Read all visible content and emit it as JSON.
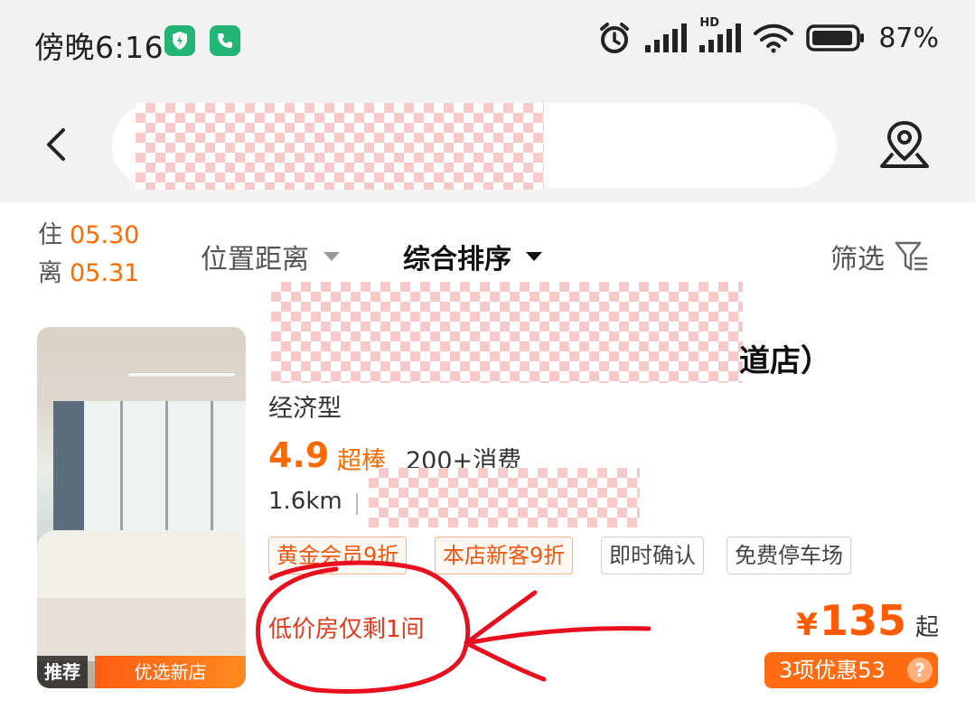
{
  "status_bar": {
    "time": "傍晚6:16",
    "battery": "87%",
    "hd_label": "HD"
  },
  "header": {
    "back_icon": "chevron-left-icon",
    "map_icon": "map-pin-icon"
  },
  "filter_bar": {
    "checkin_label": "住",
    "checkin_date": "05.30",
    "checkout_label": "离",
    "checkout_date": "05.31",
    "location_sort": "位置距离",
    "overall_sort": "综合排序",
    "filter": "筛选"
  },
  "hotel": {
    "name_suffix": "道店）",
    "type": "经济型",
    "score": "4.9",
    "score_word": "超棒",
    "consumption": "200+消费",
    "distance": "1.6km",
    "badge_recommend": "推荐",
    "badge_new": "优选新店",
    "tags": [
      "黄金会员9折",
      "本店新客9折",
      "即时确认",
      "免费停车场"
    ],
    "scarcity": "低价房仅剩1间",
    "price_currency": "¥",
    "price": "135",
    "price_suffix": "起",
    "discount": "3项优惠53",
    "discount_help": "?"
  },
  "colors": {
    "accent": "#ff6a00",
    "annotation": "#e8101e",
    "header_bg": "#f2f2f2"
  }
}
